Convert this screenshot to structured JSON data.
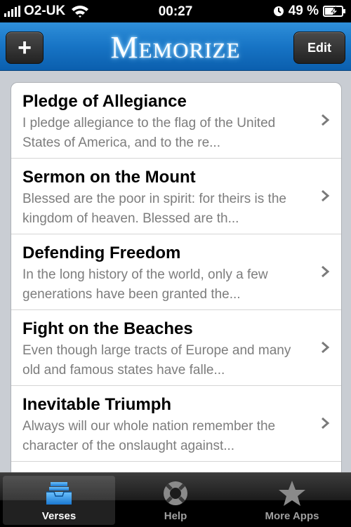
{
  "status_bar": {
    "carrier": "O2-UK",
    "time": "00:27",
    "battery": "49 %"
  },
  "nav": {
    "title": "Memorize",
    "add_label": "+",
    "edit_label": "Edit"
  },
  "verses": [
    {
      "title": "Pledge of Allegiance",
      "preview": "I pledge allegiance to the flag of the United States of America, and to the re..."
    },
    {
      "title": "Sermon on the Mount",
      "preview": "Blessed are the poor in spirit: for theirs is the kingdom of heaven. Blessed are th..."
    },
    {
      "title": "Defending Freedom",
      "preview": "In the long history of the world, only a few generations have been granted the..."
    },
    {
      "title": "Fight on the Beaches",
      "preview": "Even though large tracts of Europe and many old and famous states have falle..."
    },
    {
      "title": "Inevitable Triumph",
      "preview": "Always will our whole nation remember the character of the onslaught against..."
    }
  ],
  "tabs": [
    {
      "label": "Verses",
      "icon": "inbox-tray-icon"
    },
    {
      "label": "Help",
      "icon": "lifebuoy-icon"
    },
    {
      "label": "More Apps",
      "icon": "star-icon"
    }
  ],
  "colors": {
    "nav_blue": "#1774c5",
    "tab_active_icon": "#2b8de0"
  }
}
